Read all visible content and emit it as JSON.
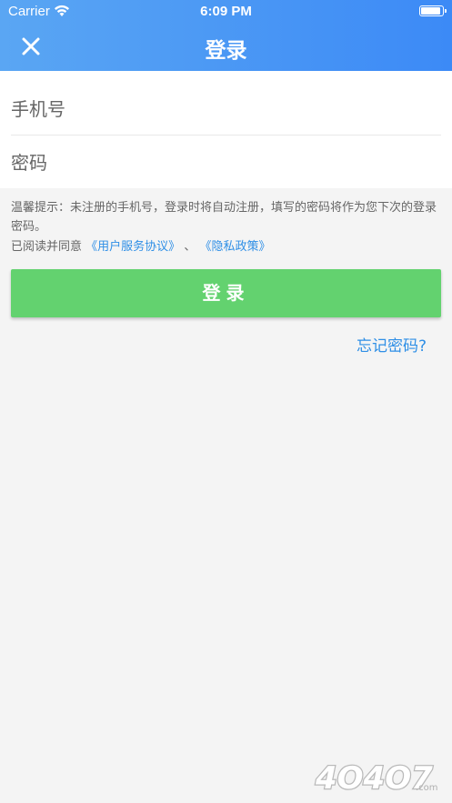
{
  "status_bar": {
    "carrier": "Carrier",
    "time": "6:09 PM"
  },
  "header": {
    "title": "登录",
    "close_icon": "close-icon",
    "background_colors": [
      "#5aa6f3",
      "#3c8af6"
    ]
  },
  "form": {
    "phone": {
      "value": "",
      "placeholder": "手机号"
    },
    "password": {
      "value": "",
      "placeholder": "密码"
    }
  },
  "hint": {
    "text": "温馨提示：未注册的手机号，登录时将自动注册，填写的密码将作为您下次的登录密码。"
  },
  "agreement": {
    "prefix": "已阅读并同意",
    "user_agreement": "《用户服务协议》",
    "separator": "、",
    "privacy_policy": "《隐私政策》"
  },
  "login_button": {
    "label": "登录",
    "color": "#63d26f"
  },
  "forgot_password": {
    "label": "忘记密码?"
  },
  "watermark": {
    "text": "4O4O7.com"
  },
  "colors": {
    "link": "#2f8fe6",
    "background": "#f4f4f4"
  }
}
